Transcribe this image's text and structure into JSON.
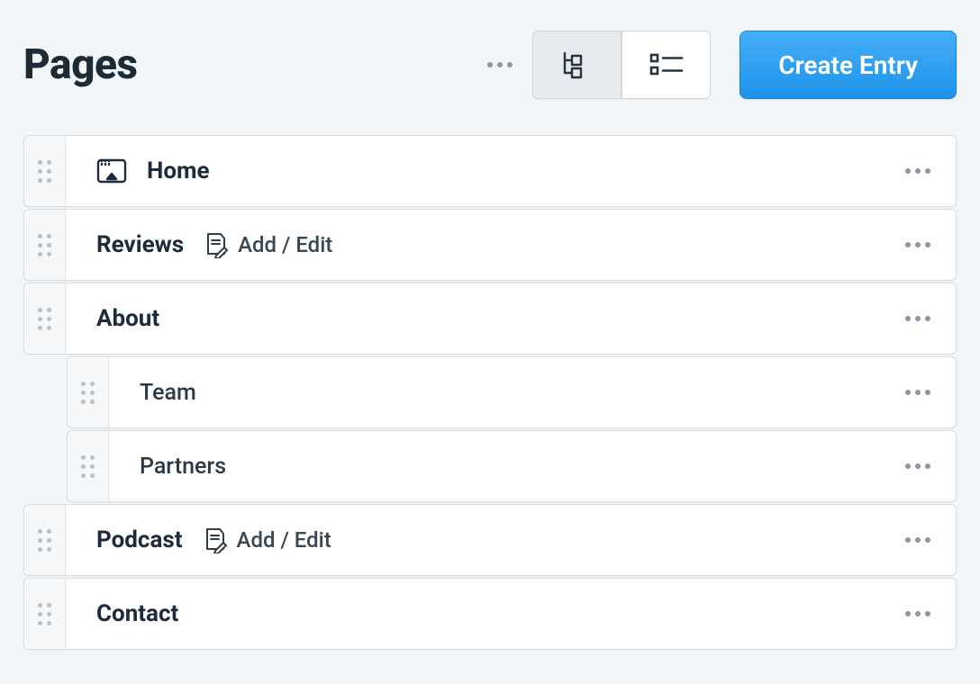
{
  "header": {
    "title": "Pages",
    "create_label": "Create Entry"
  },
  "rows": [
    {
      "label": "Home"
    },
    {
      "label": "Reviews",
      "action_label": "Add / Edit"
    },
    {
      "label": "About"
    },
    {
      "label": "Team"
    },
    {
      "label": "Partners"
    },
    {
      "label": "Podcast",
      "action_label": "Add / Edit"
    },
    {
      "label": "Contact"
    }
  ]
}
